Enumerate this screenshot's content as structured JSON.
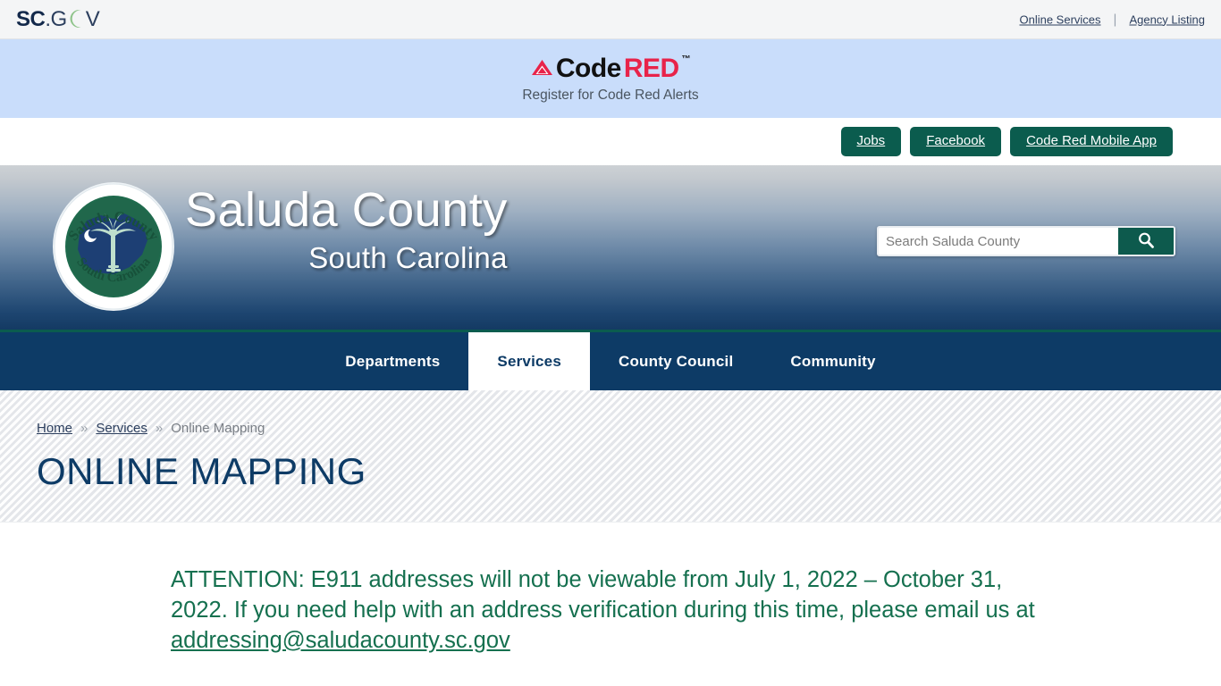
{
  "scgov": {
    "logo": {
      "sc": "SC",
      "dot_g": ".G",
      "moon_icon": "crescent-moon-icon",
      "v": "V"
    },
    "links": [
      {
        "label": "Online Services"
      },
      {
        "label": "Agency Listing"
      }
    ],
    "separator": "|"
  },
  "codered": {
    "icon": "codered-triangle-icon",
    "code": "Code",
    "red": "RED",
    "tm": "™",
    "subtitle": "Register for Code Red Alerts",
    "background": "#c9ddfb",
    "red_color": "#e8234a"
  },
  "quick_buttons": [
    {
      "label": "Jobs"
    },
    {
      "label": "Facebook"
    },
    {
      "label": "Code Red Mobile App"
    }
  ],
  "masthead": {
    "seal": {
      "top_text": "Saluda County",
      "bottom_text": "South Carolina",
      "icon": "county-seal-icon"
    },
    "title": "Saluda County",
    "subtitle": "South Carolina"
  },
  "search": {
    "placeholder": "Search Saluda County",
    "value": "",
    "button_icon": "search-icon"
  },
  "nav": {
    "items": [
      {
        "label": "Departments",
        "active": false
      },
      {
        "label": "Services",
        "active": true
      },
      {
        "label": "County Council",
        "active": false
      },
      {
        "label": "Community",
        "active": false
      }
    ],
    "background": "#0d3b66",
    "accent": "#0b5c4e"
  },
  "breadcrumb": {
    "items": [
      {
        "label": "Home",
        "link": true
      },
      {
        "label": "Services",
        "link": true
      },
      {
        "label": "Online Mapping",
        "link": false
      }
    ],
    "separator": "»"
  },
  "page": {
    "title": "ONLINE MAPPING"
  },
  "main": {
    "attention_part1": "ATTENTION:  E911 addresses will not be viewable from July 1, 2022 – October 31, 2022. If you need help with an address verification during this time, please email us at ",
    "attention_email": "addressing@saludacounty.sc.gov",
    "text_color": "#15704f"
  }
}
